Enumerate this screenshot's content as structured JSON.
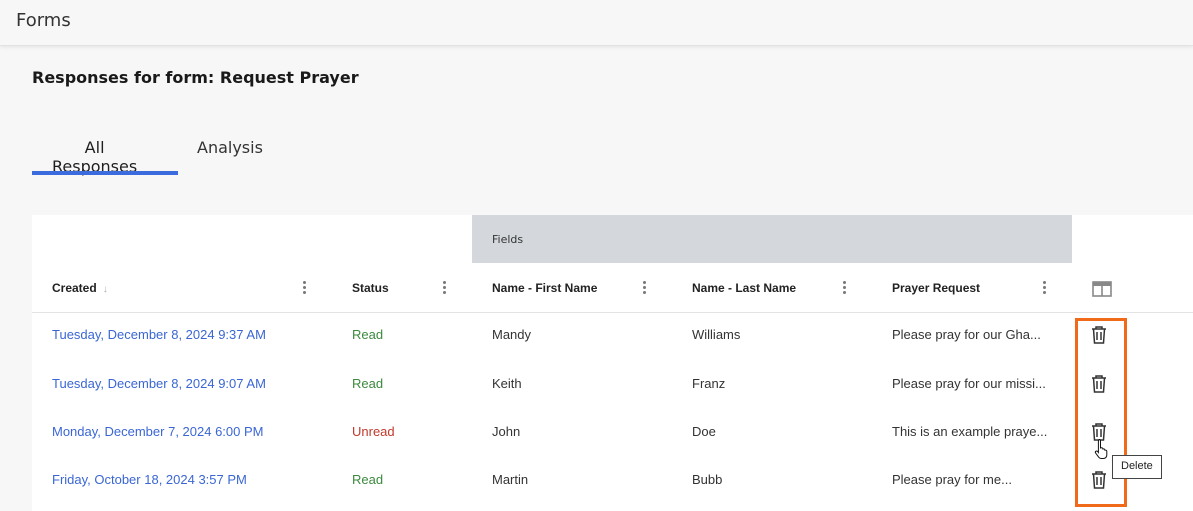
{
  "app": {
    "title": "Forms"
  },
  "page": {
    "title": "Responses for form: Request Prayer"
  },
  "tabs": [
    {
      "label": "All Responses",
      "active": true
    },
    {
      "label": "Analysis",
      "active": false
    }
  ],
  "table": {
    "group_label": "Fields",
    "columns": [
      {
        "label": "Created",
        "sort_icon": "↓"
      },
      {
        "label": "Status"
      },
      {
        "label": "Name - First Name"
      },
      {
        "label": "Name - Last Name"
      },
      {
        "label": "Prayer Request"
      }
    ],
    "column_toggle_icon": "columns-icon",
    "rows": [
      {
        "created": "Tuesday, December 8, 2024 9:37 AM",
        "status": "Read",
        "first": "Mandy",
        "last": "Williams",
        "request": "Please pray for our Gha..."
      },
      {
        "created": "Tuesday, December 8, 2024 9:07 AM",
        "status": "Read",
        "first": "Keith",
        "last": "Franz",
        "request": "Please pray for our missi..."
      },
      {
        "created": "Monday, December 7, 2024 6:00 PM",
        "status": "Unread",
        "first": "John",
        "last": "Doe",
        "request": "This is an example praye..."
      },
      {
        "created": "Friday, October 18, 2024 3:57 PM",
        "status": "Read",
        "first": "Martin",
        "last": "Bubb",
        "request": "Please pray for me..."
      }
    ]
  },
  "tooltip": {
    "text": "Delete"
  },
  "colors": {
    "accent": "#3b6bdd",
    "link": "#3a66d4",
    "status_read": "#3b8a3e",
    "status_unread": "#c0392b",
    "highlight": "#f06a1a"
  }
}
